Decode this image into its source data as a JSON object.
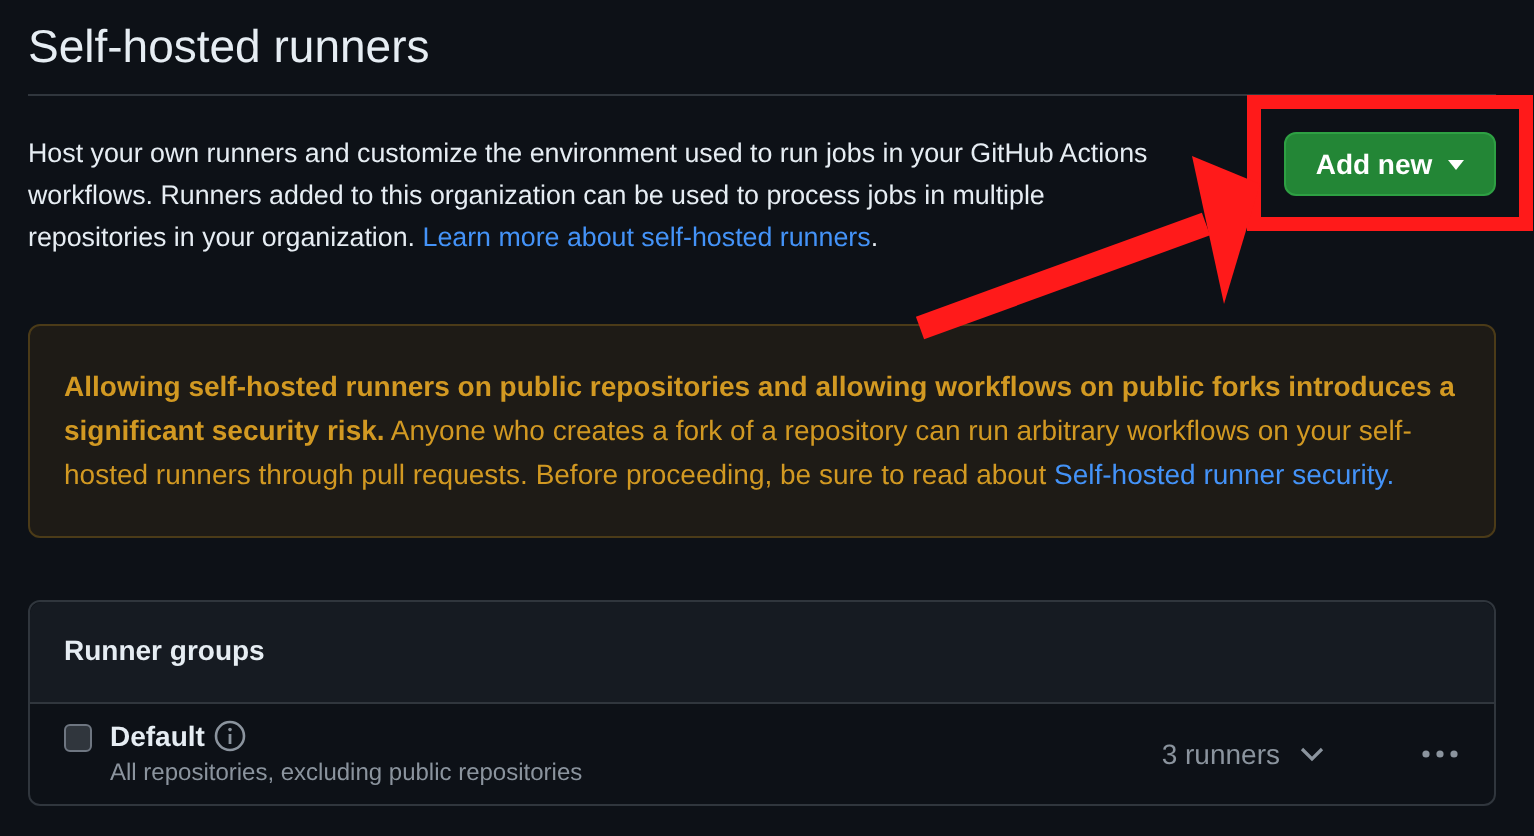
{
  "title": "Self-hosted runners",
  "description": {
    "text": "Host your own runners and customize the environment used to run jobs in your GitHub Actions workflows. Runners added to this organization can be used to process jobs in multiple repositories in your organization. ",
    "link": "Learn more about self-hosted runners",
    "end": "."
  },
  "add_button": {
    "label": "Add new"
  },
  "warning": {
    "text": "**Allowing self-hosted runners on public repositories and allowing workflows on public forks introduces a significant security risk.** Anyone who creates a fork of a repository can run arbitrary workflows on your self-hosted runners through pull requests. Before proceeding, be sure to read about ",
    "link": "Self-hosted runner security."
  },
  "runner_groups": {
    "title": "Runner groups",
    "rows": [
      {
        "name": "Default",
        "description": "All repositories, excluding public repositories",
        "count": "3 runners",
        "checked": false
      }
    ]
  }
}
